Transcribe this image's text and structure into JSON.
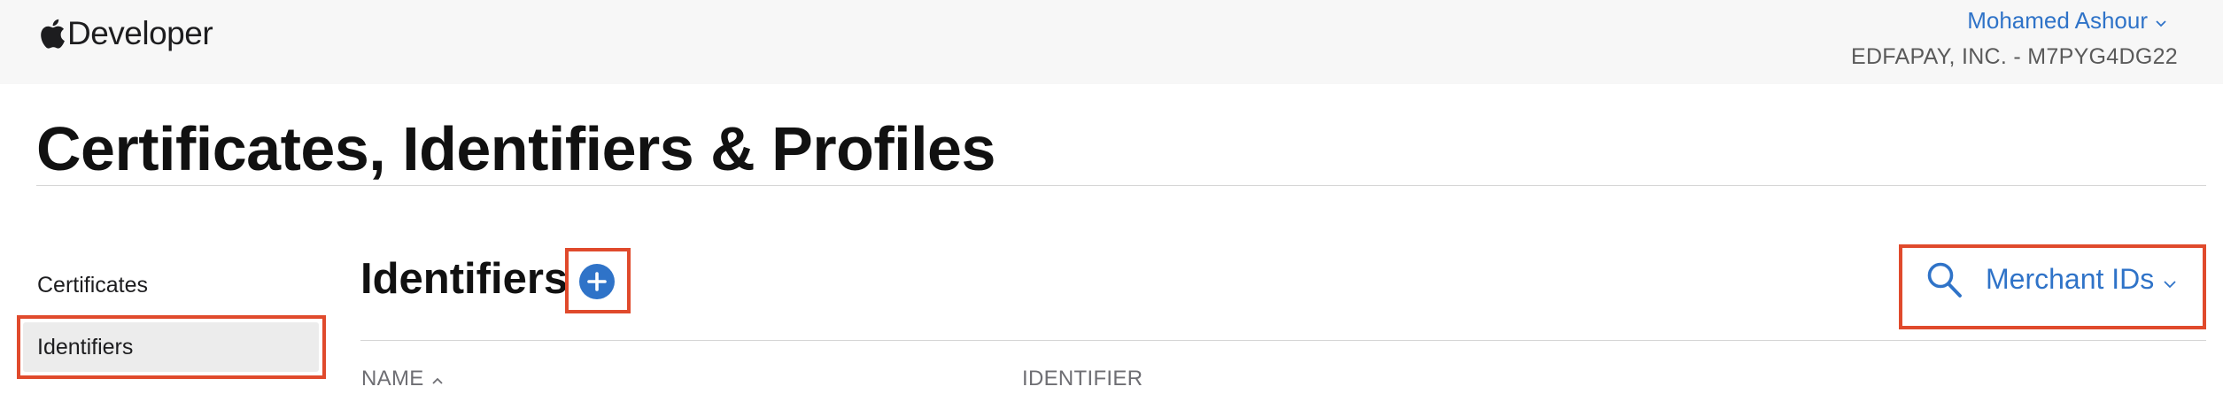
{
  "header": {
    "brand_text": "Developer",
    "user_name": "Mohamed Ashour",
    "team_name": "EDFAPAY, INC. - M7PYG4DG22"
  },
  "page": {
    "title": "Certificates, Identifiers & Profiles"
  },
  "sidebar": {
    "items": [
      {
        "label": "Certificates",
        "selected": false
      },
      {
        "label": "Identifiers",
        "selected": true
      }
    ]
  },
  "section": {
    "title": "Identifiers",
    "filter_value": "Merchant IDs"
  },
  "table": {
    "columns": [
      {
        "label": "NAME",
        "sort": "ascending"
      },
      {
        "label": "IDENTIFIER"
      }
    ]
  },
  "colors": {
    "accent": "#2f73c8",
    "highlight": "#e04a2c",
    "selected_bg": "#ececec",
    "header_bg": "#f7f7f7"
  },
  "icons": {
    "brand": "apple-logo-icon",
    "user_menu": "chevron-down-icon",
    "add": "plus-circle-icon",
    "search": "search-icon",
    "filter_menu": "chevron-down-icon",
    "sort": "chevron-up-icon"
  }
}
